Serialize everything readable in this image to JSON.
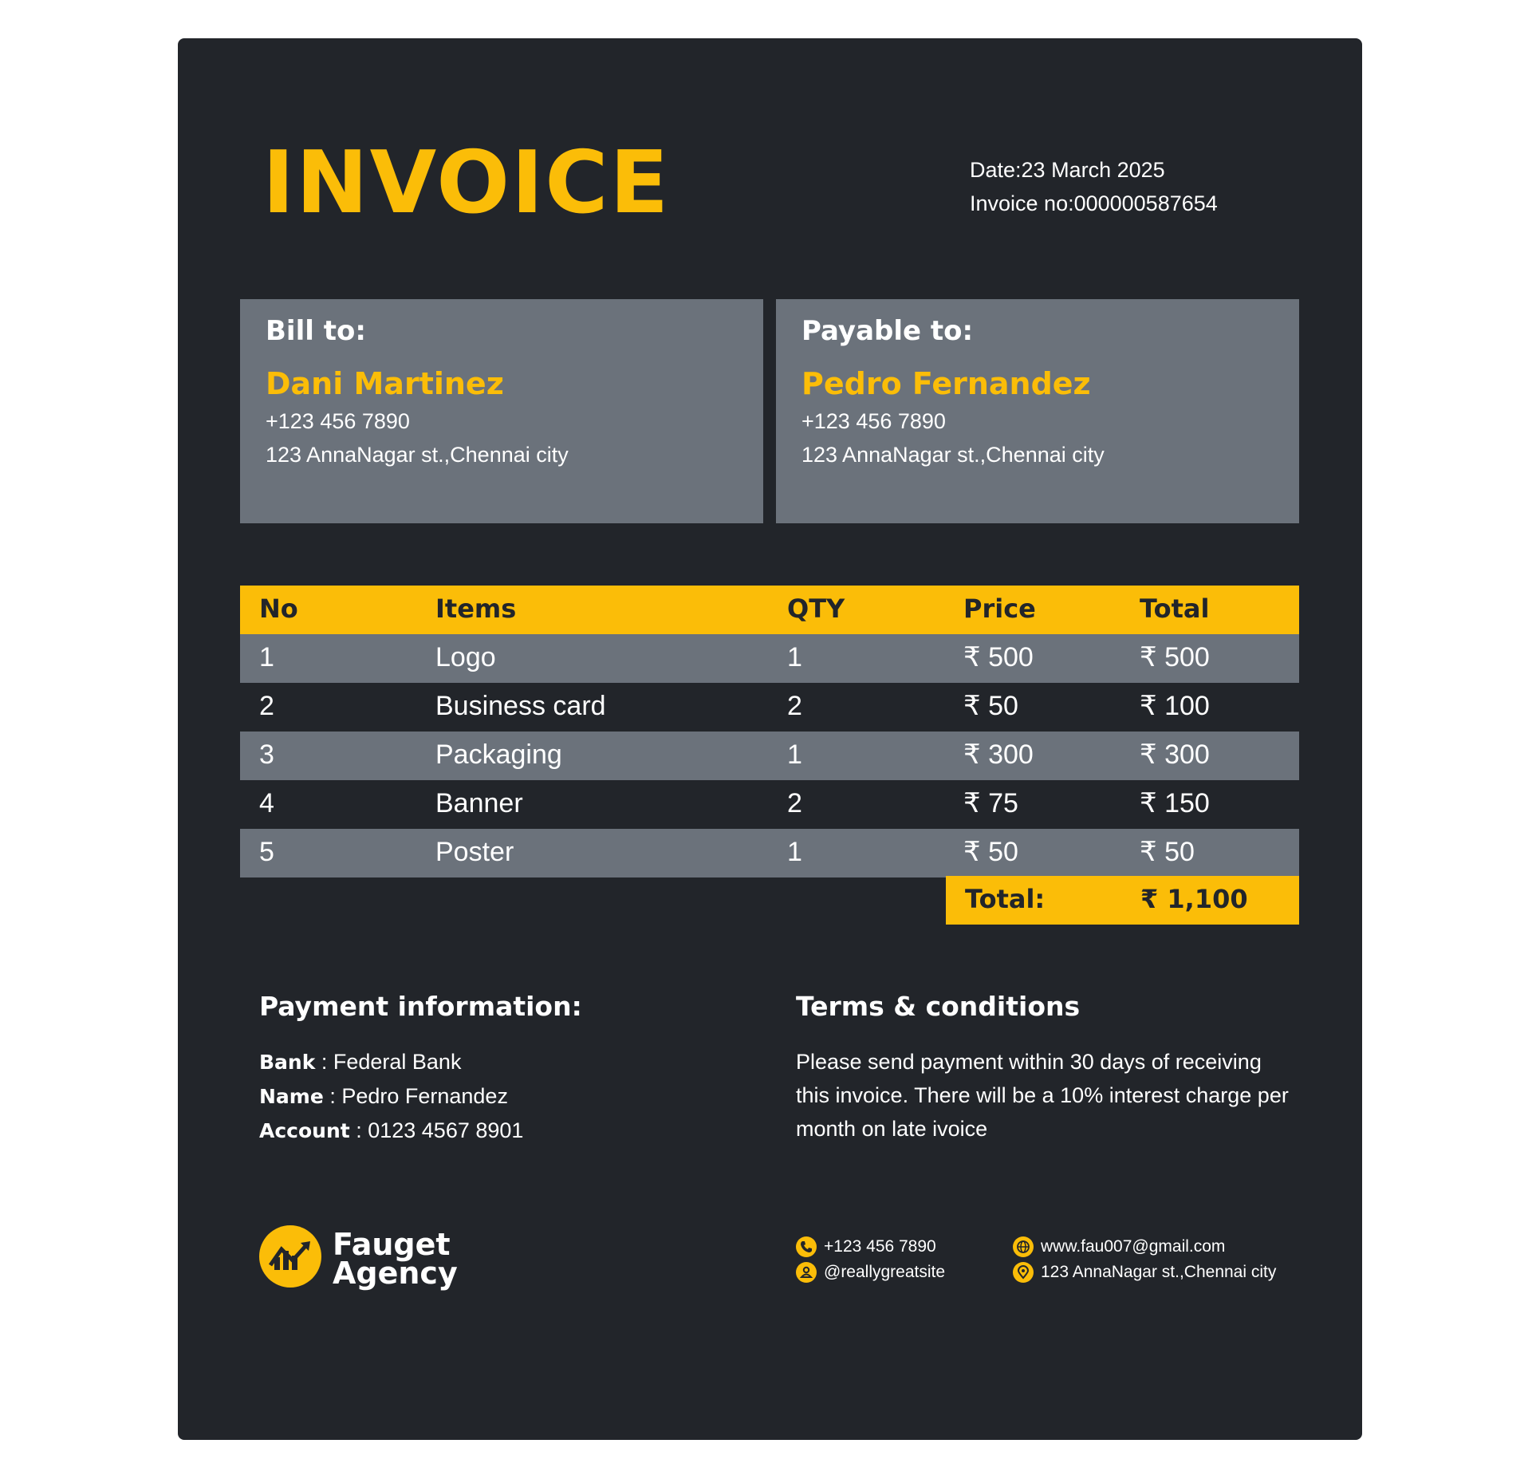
{
  "invoice": {
    "title": "INVOICE",
    "date": "Date:23 March 2025",
    "number": "Invoice no:000000587654"
  },
  "bill_to": {
    "label": "Bill to:",
    "name": "Dani Martinez",
    "phone": "+123 456 7890",
    "address": "123 AnnaNagar st.,Chennai city"
  },
  "payable_to": {
    "label": "Payable to:",
    "name": "Pedro Fernandez",
    "phone": "+123 456 7890",
    "address": "123 AnnaNagar st.,Chennai city"
  },
  "table": {
    "headers": [
      "No",
      "Items",
      "QTY",
      "Price",
      "Total"
    ],
    "rows": [
      [
        "1",
        "Logo",
        "1",
        "₹ 500",
        "₹ 500"
      ],
      [
        "2",
        "Business card",
        "2",
        "₹ 50",
        "₹ 100"
      ],
      [
        "3",
        "Packaging",
        "1",
        "₹ 300",
        "₹ 300"
      ],
      [
        "4",
        "Banner",
        "2",
        "₹ 75",
        "₹ 150"
      ],
      [
        "5",
        "Poster",
        "1",
        "₹ 50",
        "₹ 50"
      ]
    ],
    "total_label": "Total:",
    "total_value": "₹ 1,100"
  },
  "payment": {
    "heading": "Payment information:",
    "bank_label": "Bank",
    "bank_value": " : Federal Bank",
    "name_label": "Name",
    "name_value": " : Pedro Fernandez",
    "account_label": "Account",
    "account_value": " : 0123 4567 8901"
  },
  "terms": {
    "heading": "Terms & conditions",
    "text": "Please send payment within 30 days of receiving this invoice. There will be a 10% interest charge per month on late ivoice"
  },
  "brand": {
    "line1": "Fauget",
    "line2": "Agency"
  },
  "contact": {
    "phone": "+123 456 7890",
    "social": "@reallygreatsite",
    "email": "www.fau007@gmail.com",
    "address": "123 AnnaNagar st.,Chennai city"
  },
  "colors": {
    "background": "#22252a",
    "accent": "#fbbd08",
    "panel": "#6b727b"
  }
}
